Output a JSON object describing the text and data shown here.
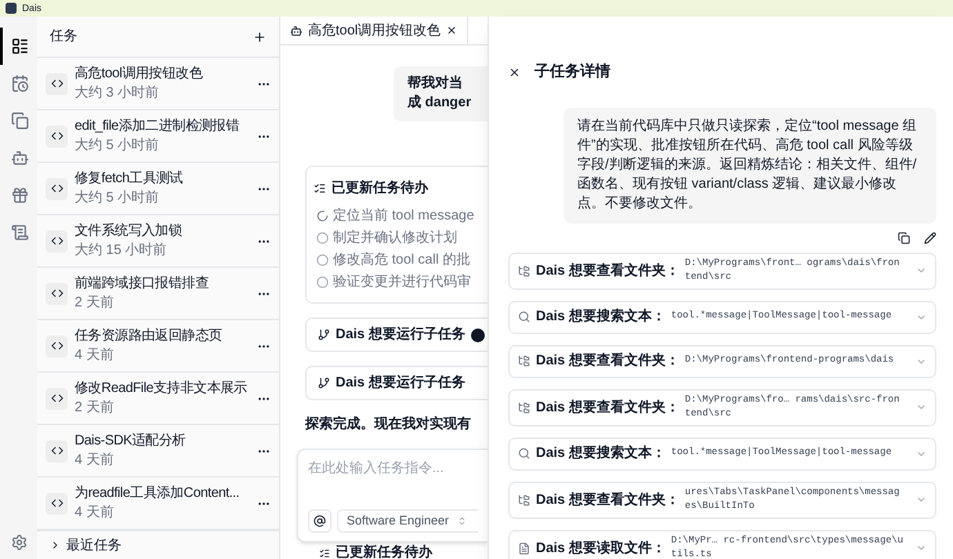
{
  "window": {
    "title": "Dais"
  },
  "rail": [
    {
      "selected": true
    },
    {
      "selected": false
    },
    {
      "selected": false
    },
    {
      "selected": false
    },
    {
      "selected": false
    },
    {
      "selected": false
    }
  ],
  "tasks": {
    "title": "任务",
    "items": [
      {
        "title": "高危tool调用按钮改色",
        "time": "大约 3 小时前"
      },
      {
        "title": "edit_file添加二进制检测报错",
        "time": "大约 5 小时前"
      },
      {
        "title": "修复fetch工具测试",
        "time": "大约 5 小时前"
      },
      {
        "title": "文件系统写入加锁",
        "time": "大约 15 小时前"
      },
      {
        "title": "前端跨域接口报错排查",
        "time": "2 天前"
      },
      {
        "title": "任务资源路由返回静态页",
        "time": "4 天前"
      },
      {
        "title": "修改ReadFile支持非文本展示",
        "time": "2 天前"
      },
      {
        "title": "Dais-SDK适配分析",
        "time": "4 天前"
      },
      {
        "title": "为readfile工具添加Content...",
        "time": "4 天前"
      }
    ],
    "recent": "最近任务"
  },
  "chat": {
    "tab": {
      "label": "高危tool调用按钮改色"
    },
    "user_message": [
      "帮我对当",
      "成 danger"
    ],
    "todo": {
      "title": "已更新任务待办",
      "items": [
        {
          "text": "定位当前 tool message",
          "kind": "in_progress"
        },
        {
          "text": "制定并确认修改计划",
          "kind": "pending"
        },
        {
          "text": "修改高危 tool call 的批",
          "kind": "pending"
        },
        {
          "text": "验证变更并进行代码审",
          "kind": "pending"
        }
      ]
    },
    "subtasks": [
      {
        "label": "Dais 想要运行子任务",
        "kind": "badge"
      },
      {
        "label": "Dais 想要运行子任务",
        "kind": "plain"
      }
    ],
    "summary": "探索完成。现在我对实现有",
    "input": {
      "placeholder": "在此处输入任务指令...",
      "mode": "Software Engineer"
    },
    "footer_todo": "已更新任务待办"
  },
  "panel": {
    "title": "子任务详情",
    "message": "请在当前代码库中只做只读探索，定位“tool message 组件”的实现、批准按钮所在代码、高危 tool call 风险等级字段/判断逻辑的来源。返回精炼结论：相关文件、组件/函数名、现有按钮 variant/class 逻辑、建议最小修改点。不要修改文件。",
    "tools": [
      {
        "kind": "folder",
        "label": "Dais 想要查看文件夹：",
        "value": "D:\\MyPrograms\\front… ograms\\dais\\frontend\\src"
      },
      {
        "kind": "search",
        "label": "Dais 想要搜索文本：",
        "value": "tool.*message|ToolMessage|tool-message"
      },
      {
        "kind": "folder",
        "label": "Dais 想要查看文件夹：",
        "value": "D:\\MyPrograms\\frontend-programs\\dais"
      },
      {
        "kind": "folder",
        "label": "Dais 想要查看文件夹：",
        "value": "D:\\MyPrograms\\fro… rams\\dais\\src-frontend\\src"
      },
      {
        "kind": "search",
        "label": "Dais 想要搜索文本：",
        "value": "tool.*message|ToolMessage|tool-message"
      },
      {
        "kind": "folder",
        "label": "Dais 想要查看文件夹：",
        "value": "ures\\Tabs\\TaskPanel\\components\\messages\\BuiltInTo"
      },
      {
        "kind": "file",
        "label": "Dais 想要读取文件：",
        "value": "D:\\MyPr… rc-frontend\\src\\types\\message\\utils.ts"
      }
    ]
  }
}
